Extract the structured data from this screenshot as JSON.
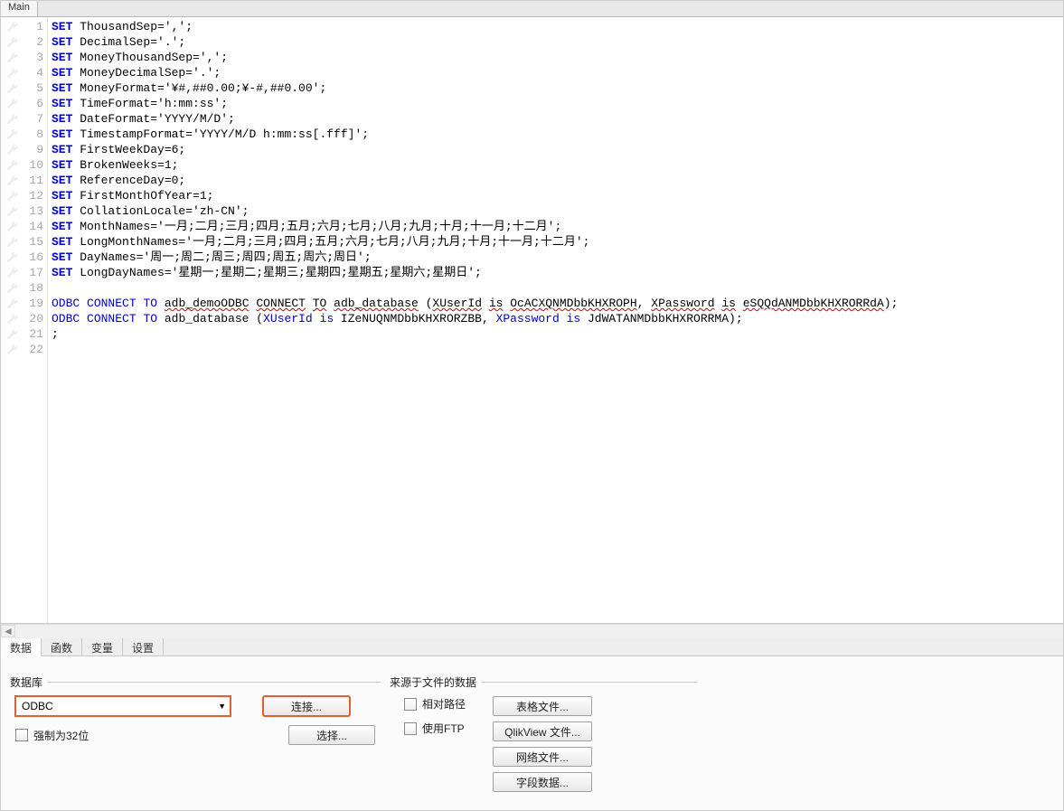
{
  "top_tab": "Main",
  "code_lines": [
    {
      "num": 1,
      "html": "<span class='kw'>SET</span> ThousandSep=',';"
    },
    {
      "num": 2,
      "html": "<span class='kw'>SET</span> DecimalSep='.';"
    },
    {
      "num": 3,
      "html": "<span class='kw'>SET</span> MoneyThousandSep=',';"
    },
    {
      "num": 4,
      "html": "<span class='kw'>SET</span> MoneyDecimalSep='.';"
    },
    {
      "num": 5,
      "html": "<span class='kw'>SET</span> MoneyFormat='¥#,##0.00;¥-#,##0.00';"
    },
    {
      "num": 6,
      "html": "<span class='kw'>SET</span> TimeFormat='h:mm:ss';"
    },
    {
      "num": 7,
      "html": "<span class='kw'>SET</span> DateFormat='YYYY/M/D';"
    },
    {
      "num": 8,
      "html": "<span class='kw'>SET</span> TimestampFormat='YYYY/M/D h:mm:ss[.fff]';"
    },
    {
      "num": 9,
      "html": "<span class='kw'>SET</span> FirstWeekDay=6;"
    },
    {
      "num": 10,
      "html": "<span class='kw'>SET</span> BrokenWeeks=1;"
    },
    {
      "num": 11,
      "html": "<span class='kw'>SET</span> ReferenceDay=0;"
    },
    {
      "num": 12,
      "html": "<span class='kw'>SET</span> FirstMonthOfYear=1;"
    },
    {
      "num": 13,
      "html": "<span class='kw'>SET</span> CollationLocale='zh-CN';"
    },
    {
      "num": 14,
      "html": "<span class='kw'>SET</span> MonthNames='一月;二月;三月;四月;五月;六月;七月;八月;九月;十月;十一月;十二月';"
    },
    {
      "num": 15,
      "html": "<span class='kw'>SET</span> LongMonthNames='一月;二月;三月;四月;五月;六月;七月;八月;九月;十月;十一月;十二月';"
    },
    {
      "num": 16,
      "html": "<span class='kw'>SET</span> DayNames='周一;周二;周三;周四;周五;周六;周日';"
    },
    {
      "num": 17,
      "html": "<span class='kw'>SET</span> LongDayNames='星期一;星期二;星期三;星期四;星期五;星期六;星期日';"
    },
    {
      "num": 18,
      "html": ""
    },
    {
      "num": 19,
      "html": "<span class='kw2'>ODBC</span> <span class='kw2'>CONNECT</span> <span class='kw2'>TO</span> <span class='squig'>adb_demoODBC</span> <span class='squig'>CONNECT</span> <span class='squig'>TO</span> <span class='squig'>adb_database</span> (<span class='squig'>XUserId</span> <span class='squig'>is</span> <span class='squig'>OcACXQNMDbbKHXROPH</span>, <span class='squig'>XPassword</span> <span class='squig'>is</span> <span class='squig'>eSQQdANMDbbKHXRORRdA</span>);"
    },
    {
      "num": 20,
      "html": "<span class='kw2'>ODBC</span> <span class='kw2'>CONNECT</span> <span class='kw2'>TO</span> adb_database (<span class='kw2'>XUserId</span> <span class='kw2'>is</span> IZeNUQNMDbbKHXRORZBB, <span class='kw2'>XPassword</span> <span class='kw2'>is</span> JdWATANMDbbKHXRORRMA);"
    },
    {
      "num": 21,
      "html": ";"
    },
    {
      "num": 22,
      "html": ""
    }
  ],
  "bottom_tabs": [
    "数据",
    "函数",
    "变量",
    "设置"
  ],
  "database": {
    "legend": "数据库",
    "selected": "ODBC",
    "connect_btn": "连接...",
    "select_btn": "选择...",
    "force32_label": "强制为32位"
  },
  "filedata": {
    "legend": "来源于文件的数据",
    "relative_path_label": "相对路径",
    "use_ftp_label": "使用FTP",
    "buttons": [
      "表格文件...",
      "QlikView 文件...",
      "网络文件...",
      "字段数据..."
    ]
  }
}
